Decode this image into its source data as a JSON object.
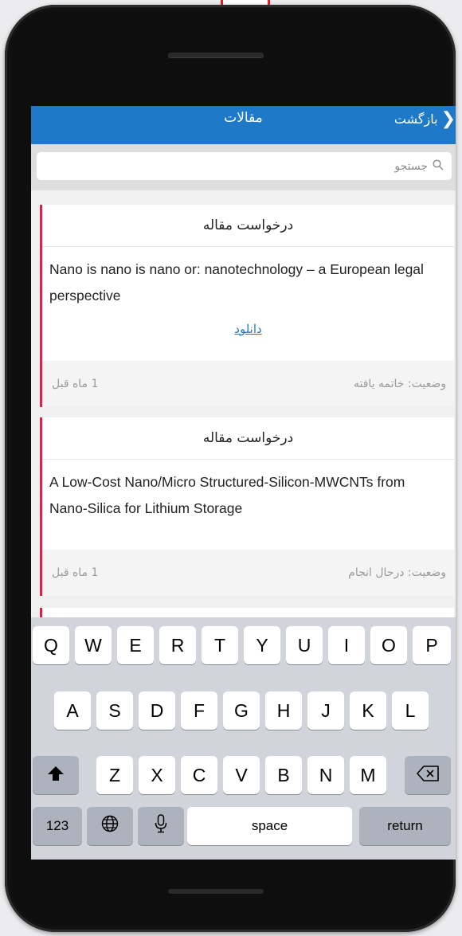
{
  "nav": {
    "title": "مقالات",
    "back_label": "بازگشت"
  },
  "search": {
    "placeholder": "جستجو"
  },
  "cards": [
    {
      "header": "درخواست مقاله",
      "title": "Nano is nano is nano or: nanotechnology – a European legal perspective",
      "download": "دانلود",
      "status": "وضعیت: خاتمه یافته",
      "time": "1 ماه قبل"
    },
    {
      "header": "درخواست مقاله",
      "title": "A Low-Cost Nano/Micro Structured-Silicon-MWCNTs from Nano-Silica for Lithium Storage",
      "status": "وضعیت: درحال انجام",
      "time": "1 ماه قبل"
    }
  ],
  "keyboard": {
    "row1": [
      "Q",
      "W",
      "E",
      "R",
      "T",
      "Y",
      "U",
      "I",
      "O",
      "P"
    ],
    "row2": [
      "A",
      "S",
      "D",
      "F",
      "G",
      "H",
      "J",
      "K",
      "L"
    ],
    "row3": [
      "Z",
      "X",
      "C",
      "V",
      "B",
      "N",
      "M"
    ],
    "numbers_label": "123",
    "space_label": "space",
    "return_label": "return"
  },
  "colors": {
    "accent": "#1e7ac8",
    "card_stripe": "#e21f4d"
  },
  "icons": [
    "back-chevron-icon",
    "search-icon",
    "shift-icon",
    "backspace-icon",
    "globe-icon",
    "microphone-icon"
  ]
}
